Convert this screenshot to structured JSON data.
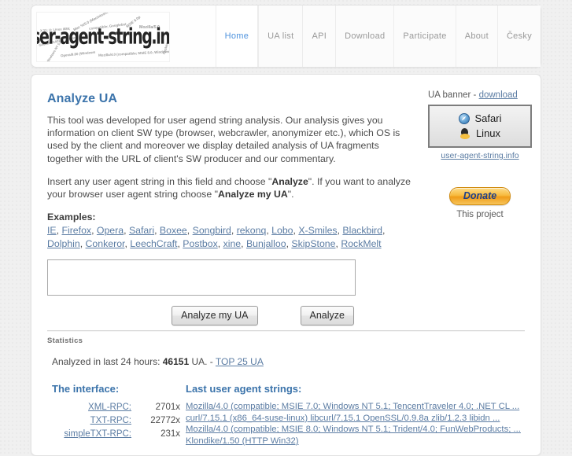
{
  "header": {
    "logo_text": "user-agent-string.info",
    "logo_cloud": [
      "X 11; U; Linux i686;",
      "Mac %/5.0 (Macintosh;",
      "compatible; Googlebot",
      "MSIE 6.0p",
      "Mozilla/5.0",
      "Gecko/20100101 Firefox",
      "Windows NT 5.1",
      "Opera/9.80 (Windows",
      "Mozilla/4.0 (compatible; MSIE 8.0; Windows NT 5.1;",
      "AppleWebKit/533"
    ],
    "nav": [
      {
        "label": "Home",
        "active": true
      },
      {
        "label": "UA list",
        "active": false
      },
      {
        "label": "API",
        "active": false
      },
      {
        "label": "Download",
        "active": false
      },
      {
        "label": "Participate",
        "active": false
      },
      {
        "label": "About",
        "active": false
      },
      {
        "label": "Česky",
        "active": false
      }
    ]
  },
  "main": {
    "title": "Analyze UA",
    "paragraph1_a": "This tool was developed for user agend string analysis. Our analysis gives you information on client SW type (browser, webcrawler, anonymizer etc.), which OS is used by the client and moreover we display detailed analysis of UA fragments together with the URL of client's SW producer and our commentary.",
    "paragraph2_pre": "Insert any user agent string in this field and choose \"",
    "paragraph2_b1": "Analyze",
    "paragraph2_mid": "\". If you want to analyze your browser user agent string choose \"",
    "paragraph2_b2": "Analyze my UA",
    "paragraph2_post": "\".",
    "examples_label": "Examples:",
    "examples": [
      "IE",
      "Firefox",
      "Opera",
      "Safari",
      "Boxee",
      "Songbird",
      "rekonq",
      "Lobo",
      "X-Smiles",
      "Blackbird",
      "Dolphin",
      "Conkeror",
      "LeechCraft",
      "Postbox",
      "xine",
      "Bunjalloo",
      "SkipStone",
      "RockMelt"
    ],
    "textarea_value": "",
    "textarea_placeholder": "",
    "btn_analyze_my_ua": "Analyze my UA",
    "btn_analyze": "Analyze"
  },
  "sidebar": {
    "banner_label_pre": "UA banner - ",
    "banner_download_link": "download",
    "banner_browser": "Safari",
    "banner_os": "Linux",
    "banner_credit": "user-agent-string.info",
    "donate_label": "Donate",
    "donate_caption": "This project"
  },
  "statistics": {
    "section_title": "Statistics",
    "analyzed_pre": "Analyzed in last 24 hours: ",
    "analyzed_count": "46151",
    "analyzed_post": " UA. - ",
    "top_link": "TOP 25 UA",
    "interface_title": "The interface:",
    "interface_rows": [
      {
        "name": "XML-RPC:",
        "count": "2701x"
      },
      {
        "name": "TXT-RPC:",
        "count": "22772x"
      },
      {
        "name": "simpleTXT-RPC:",
        "count": "231x"
      }
    ],
    "last_ua_title": "Last user agent strings:",
    "last_ua_strings": [
      "Mozilla/4.0 (compatible; MSIE 7.0; Windows NT 5.1; TencentTraveler 4.0; .NET CL ...",
      "curl/7.15.1 (x86_64-suse-linux) libcurl/7.15.1 OpenSSL/0.9.8a zlib/1.2.3 libidn ...",
      "Mozilla/4.0 (compatible; MSIE 8.0; Windows NT 5.1; Trident/4.0; FunWebProducts; ...",
      "Klondike/1.50 (HTTP Win32)"
    ]
  },
  "colors": {
    "accent": "#3c74ab",
    "link": "#5b7ca3",
    "nav_active": "#4f93de",
    "donate": "#f7bb3f"
  }
}
